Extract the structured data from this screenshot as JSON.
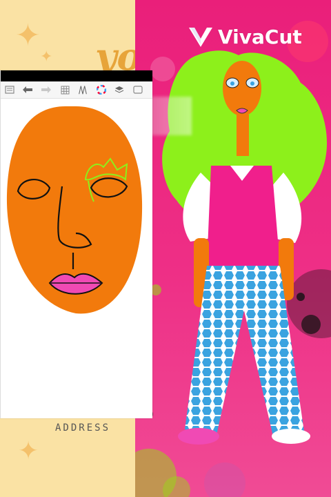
{
  "watermark": {
    "brand": "VivaCut",
    "logo_icon": "vivacut-v-logo"
  },
  "background": {
    "left_color": "#fae2a4",
    "right_color": "#ea1f7a",
    "decor_text": "yo"
  },
  "drawing_app": {
    "toolbar": [
      {
        "name": "gallery",
        "icon": "gallery-icon"
      },
      {
        "name": "undo",
        "icon": "undo-arrow-icon"
      },
      {
        "name": "redo",
        "icon": "redo-arrow-icon"
      },
      {
        "name": "grid",
        "icon": "grid-icon"
      },
      {
        "name": "brush",
        "icon": "brush-tool-icon"
      },
      {
        "name": "color",
        "icon": "color-wheel-icon"
      },
      {
        "name": "layers",
        "icon": "layers-icon"
      },
      {
        "name": "fullscreen",
        "icon": "fullscreen-icon"
      }
    ],
    "face_color": "#f27a0c",
    "lip_color": "#f04ab4",
    "highlight_color": "#8df01b"
  },
  "label": "ADDRESS",
  "character": {
    "hair_color": "#8df01b",
    "shirt_color": "#f01f8c",
    "pants_color": "#3aa3e0"
  }
}
